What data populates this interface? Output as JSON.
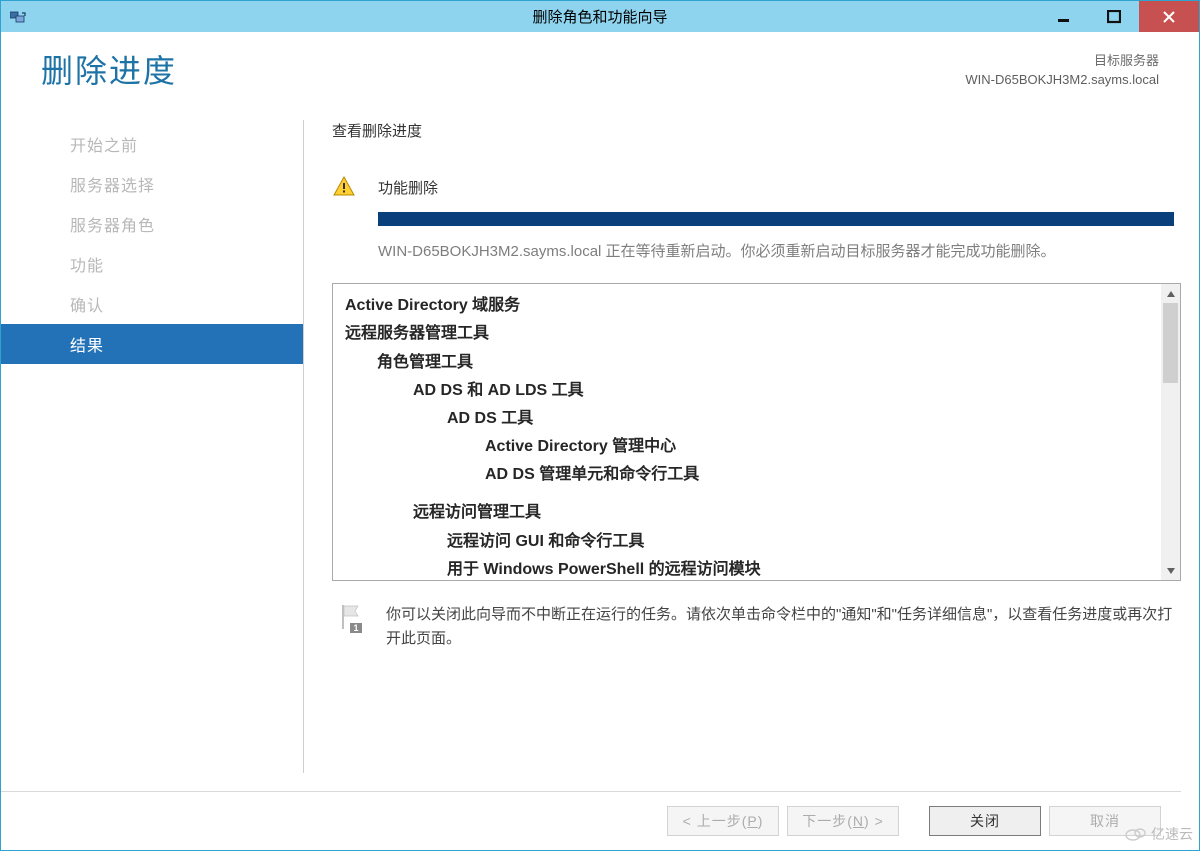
{
  "window": {
    "title": "删除角色和功能向导"
  },
  "header": {
    "page_title": "删除进度",
    "target_label": "目标服务器",
    "target_server": "WIN-D65BOKJH3M2.sayms.local"
  },
  "sidebar": {
    "items": [
      {
        "label": "开始之前",
        "active": false
      },
      {
        "label": "服务器选择",
        "active": false
      },
      {
        "label": "服务器角色",
        "active": false
      },
      {
        "label": "功能",
        "active": false
      },
      {
        "label": "确认",
        "active": false
      },
      {
        "label": "结果",
        "active": true
      }
    ]
  },
  "content": {
    "section_title": "查看删除进度",
    "status_heading": "功能删除",
    "progress_percent": 100,
    "status_message": "WIN-D65BOKJH3M2.sayms.local 正在等待重新启动。你必须重新启动目标服务器才能完成功能删除。",
    "results": [
      {
        "level": 0,
        "text": "Active Directory 域服务"
      },
      {
        "level": 0,
        "text": "远程服务器管理工具"
      },
      {
        "level": 1,
        "text": "角色管理工具"
      },
      {
        "level": 2,
        "text": "AD DS 和 AD LDS 工具"
      },
      {
        "level": 3,
        "text": "AD DS 工具"
      },
      {
        "level": 4,
        "text": "Active Directory 管理中心"
      },
      {
        "level": 4,
        "text": "AD DS 管理单元和命令行工具"
      },
      {
        "level": 2,
        "text": "远程访问管理工具",
        "gap": true
      },
      {
        "level": 3,
        "text": "远程访问 GUI 和命令行工具"
      },
      {
        "level": 3,
        "text": "用于 Windows PowerShell 的远程访问模块"
      }
    ],
    "note": "你可以关闭此向导而不中断正在运行的任务。请依次单击命令栏中的\"通知\"和\"任务详细信息\"，以查看任务进度或再次打开此页面。"
  },
  "buttons": {
    "prev_prefix": "< 上一步(",
    "prev_key": "P",
    "prev_suffix": ")",
    "next_prefix": "下一步(",
    "next_key": "N",
    "next_suffix": ") >",
    "close": "关闭",
    "cancel": "取消"
  },
  "watermark": "亿速云"
}
